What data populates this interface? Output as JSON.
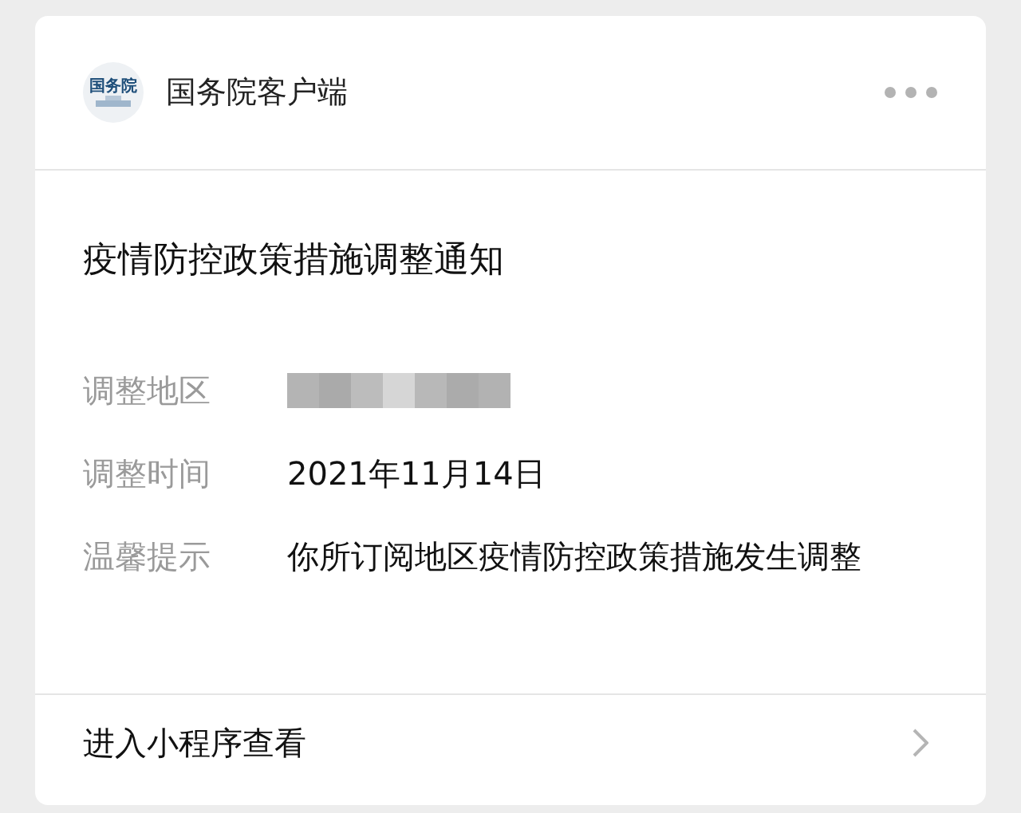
{
  "account": {
    "logo_text": "国务院",
    "name": "国务院客户端"
  },
  "title": "疫情防控政策措施调整通知",
  "fields": [
    {
      "label": "调整地区",
      "kind": "blurred"
    },
    {
      "label": "调整时间",
      "kind": "text",
      "value": "2021年11月14日"
    },
    {
      "label": "温馨提示",
      "kind": "text",
      "value": "你所订阅地区疫情防控政策措施发生调整"
    }
  ],
  "footer": {
    "link": "进入小程序查看"
  }
}
